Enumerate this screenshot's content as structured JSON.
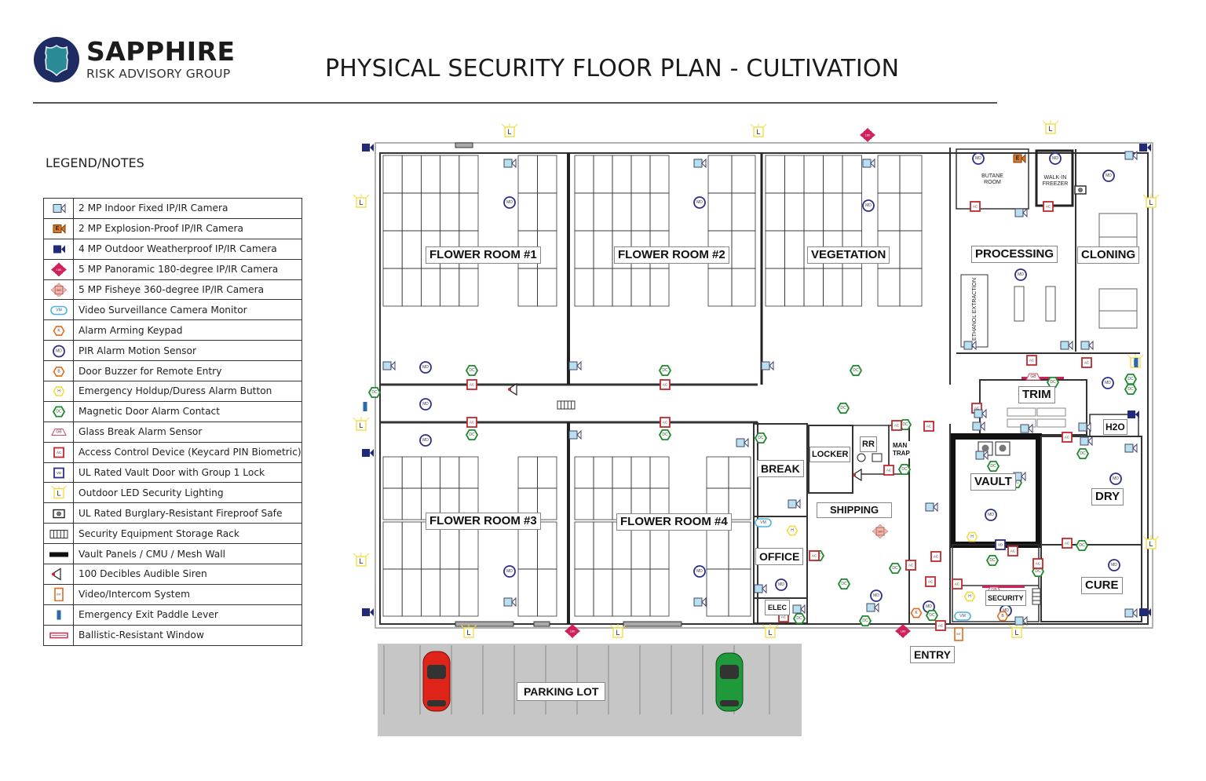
{
  "brand": {
    "name": "SAPPHIRE",
    "subtitle": "RISK ADVISORY GROUP",
    "colors": {
      "navy": "#1f2b63",
      "teal": "#2a8a95"
    }
  },
  "title": "PHYSICAL SECURITY FLOOR PLAN - CULTIVATION",
  "legend": {
    "title": "LEGEND/NOTES",
    "items": [
      {
        "icon": "indoor-camera-icon",
        "label": "2 MP Indoor Fixed IP/IR Camera"
      },
      {
        "icon": "explosion-proof-camera-icon",
        "label": "2 MP Explosion-Proof IP/IR Camera"
      },
      {
        "icon": "outdoor-camera-icon",
        "label": "4 MP Outdoor Weatherproof IP/IR Camera"
      },
      {
        "icon": "panoramic-camera-icon",
        "label": "5 MP Panoramic 180-degree IP/IR Camera"
      },
      {
        "icon": "fisheye-camera-icon",
        "label": "5 MP Fisheye 360-degree IP/IR Camera"
      },
      {
        "icon": "camera-monitor-icon",
        "label": "Video Surveillance Camera Monitor"
      },
      {
        "icon": "arming-keypad-icon",
        "label": "Alarm Arming Keypad"
      },
      {
        "icon": "motion-sensor-icon",
        "label": "PIR Alarm Motion Sensor"
      },
      {
        "icon": "door-buzzer-icon",
        "label": "Door Buzzer for Remote Entry"
      },
      {
        "icon": "duress-button-icon",
        "label": "Emergency Holdup/Duress Alarm Button"
      },
      {
        "icon": "door-contact-icon",
        "label": "Magnetic Door Alarm Contact"
      },
      {
        "icon": "glass-break-icon",
        "label": "Glass Break Alarm Sensor"
      },
      {
        "icon": "access-control-icon",
        "label": "Access Control Device (Keycard PIN Biometric)"
      },
      {
        "icon": "vault-door-icon",
        "label": "UL Rated Vault Door with Group 1 Lock"
      },
      {
        "icon": "led-light-icon",
        "label": "Outdoor LED Security Lighting"
      },
      {
        "icon": "safe-icon",
        "label": "UL Rated Burglary-Resistant Fireproof Safe"
      },
      {
        "icon": "storage-rack-icon",
        "label": "Security Equipment Storage Rack"
      },
      {
        "icon": "vault-wall-icon",
        "label": "Vault Panels / CMU / Mesh Wall"
      },
      {
        "icon": "siren-icon",
        "label": "100 Decibles Audible Siren"
      },
      {
        "icon": "intercom-icon",
        "label": "Video/Intercom System"
      },
      {
        "icon": "exit-paddle-icon",
        "label": "Emergency Exit Paddle Lever"
      },
      {
        "icon": "ballistic-window-icon",
        "label": "Ballistic-Resistant Window"
      }
    ]
  },
  "symbols": {
    "md": "MD",
    "dc": "DC",
    "ac": "AC",
    "vm": "VM",
    "vd": "VD",
    "gb": "GB",
    "k": "K",
    "b": "B",
    "h": "H",
    "e": "E",
    "int": "INT",
    "l": "L",
    "p180": "180",
    "f360": "360"
  },
  "rooms": {
    "flower1": "FLOWER ROOM #1",
    "flower2": "FLOWER ROOM #2",
    "vegetation": "VEGETATION",
    "processing": "PROCESSING",
    "cloning": "CLONING",
    "flower3": "FLOWER ROOM #3",
    "flower4": "FLOWER ROOM #4",
    "break": "BREAK",
    "locker": "LOCKER",
    "rr": "RR",
    "mantrap": "MAN TRAP",
    "shipping": "SHIPPING",
    "office": "OFFICE",
    "elec": "ELEC",
    "vault": "VAULT",
    "dry": "DRY",
    "trim": "TRIM",
    "h2o": "H2O",
    "cure": "CURE",
    "security": "SECURITY",
    "entry": "ENTRY",
    "parking": "PARKING LOT",
    "butane": "BUTANE ROOM",
    "freezer": "WALK-IN FREEZER",
    "ethanol": "ETHANOL EXTRACTION"
  },
  "colors": {
    "camera_fill": "#b9e0ee",
    "outdoor_camera": "#1f2b7a",
    "panoramic": "#d0215a",
    "fisheye": "#f0b8a8",
    "motion": "#2e2f87",
    "contact": "#1f8a2e",
    "access": "#c0282e",
    "light": "#f2dc3c",
    "keypad": "#e06a1c",
    "car_red": "#e0241a",
    "car_green": "#1f9a3a",
    "parking": "#c6c6c6"
  }
}
